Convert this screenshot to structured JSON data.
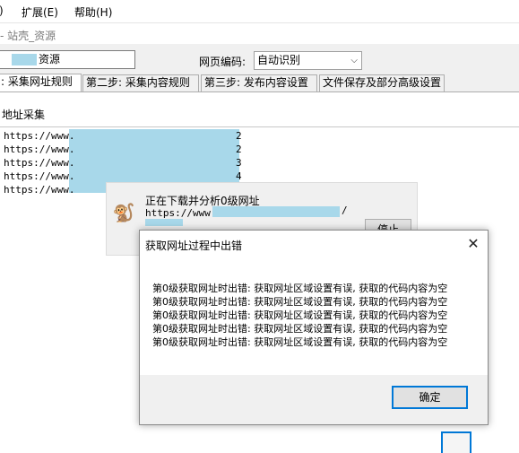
{
  "menu": {
    "items": [
      {
        "label": ")"
      },
      {
        "label": "扩展(E)"
      },
      {
        "label": "帮助(H)"
      }
    ]
  },
  "window": {
    "title": "- 站壳_资源"
  },
  "form": {
    "name_value": "资源",
    "encoding_label": "网页编码:",
    "encoding_value": "自动识别"
  },
  "tabs": [
    {
      "label": ": 采集网址规则"
    },
    {
      "label": "第二步: 采集内容规则"
    },
    {
      "label": "第三步: 发布内容设置"
    },
    {
      "label": "文件保存及部分高级设置"
    }
  ],
  "section": {
    "title": "地址采集"
  },
  "url_list": [
    {
      "text": "https://www.",
      "suffix": "2"
    },
    {
      "text": "https://www.",
      "suffix": "2"
    },
    {
      "text": "https://www.",
      "suffix": "3"
    },
    {
      "text": "https://www.",
      "suffix": "4"
    },
    {
      "text": "https://www.",
      "suffix": ""
    }
  ],
  "progress": {
    "title": "正在下载并分析0级网址",
    "url_prefix": "https://www.",
    "url_suffix": "/",
    "stop_label": "停止"
  },
  "dialog": {
    "title": "获取网址过程中出错",
    "close_glyph": "✕",
    "messages": [
      "第0级获取网址时出错: 获取网址区域设置有误, 获取的代码内容为空",
      "第0级获取网址时出错: 获取网址区域设置有误, 获取的代码内容为空",
      "第0级获取网址时出错: 获取网址区域设置有误, 获取的代码内容为空",
      "第0级获取网址时出错: 获取网址区域设置有误, 获取的代码内容为空",
      "第0级获取网址时出错: 获取网址区域设置有误, 获取的代码内容为空"
    ],
    "ok_label": "确定"
  },
  "icons": {
    "progress_icon": "monkey-icon",
    "close_icon": "close-icon"
  },
  "colors": {
    "accent": "#0078d7",
    "mask": "#a8d8ea",
    "panel_bg": "#f0f0f0"
  }
}
